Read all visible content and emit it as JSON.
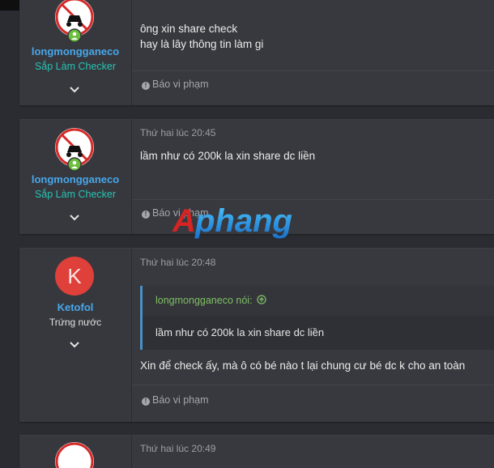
{
  "posts": [
    {
      "username": "longmongganeco",
      "user_title": "Sắp Làm Checker",
      "lines": [
        "ông xin share check",
        "hay là lây thông tin làm gi"
      ],
      "report": "Báo vi phạm"
    },
    {
      "username": "longmongganeco",
      "user_title": "Sắp Làm Checker",
      "date": "Thứ hai lúc 20:45",
      "text": "lầm như có 200k la xin share dc liền",
      "report": "Báo vi phạm"
    },
    {
      "username": "Ketofol",
      "user_title": "Trứng nước",
      "avatar_letter": "K",
      "date": "Thứ hai lúc 20:48",
      "quote": {
        "author": "longmongganeco nói:",
        "text": "lầm như có 200k la xin share dc liền"
      },
      "text": "Xin để check ấy, mà ô có bé nào t lại chung cư bé dc k cho an toàn",
      "report": "Báo vi phạm"
    },
    {
      "date": "Thứ hai lúc 20:49"
    }
  ],
  "watermark": {
    "part1": "A",
    "part2": "phang"
  },
  "colors": {
    "username": "#47a7eb",
    "user_title": "#25c3b5",
    "quote_author": "#7fbf64",
    "avatar_k": "#e0403a"
  }
}
